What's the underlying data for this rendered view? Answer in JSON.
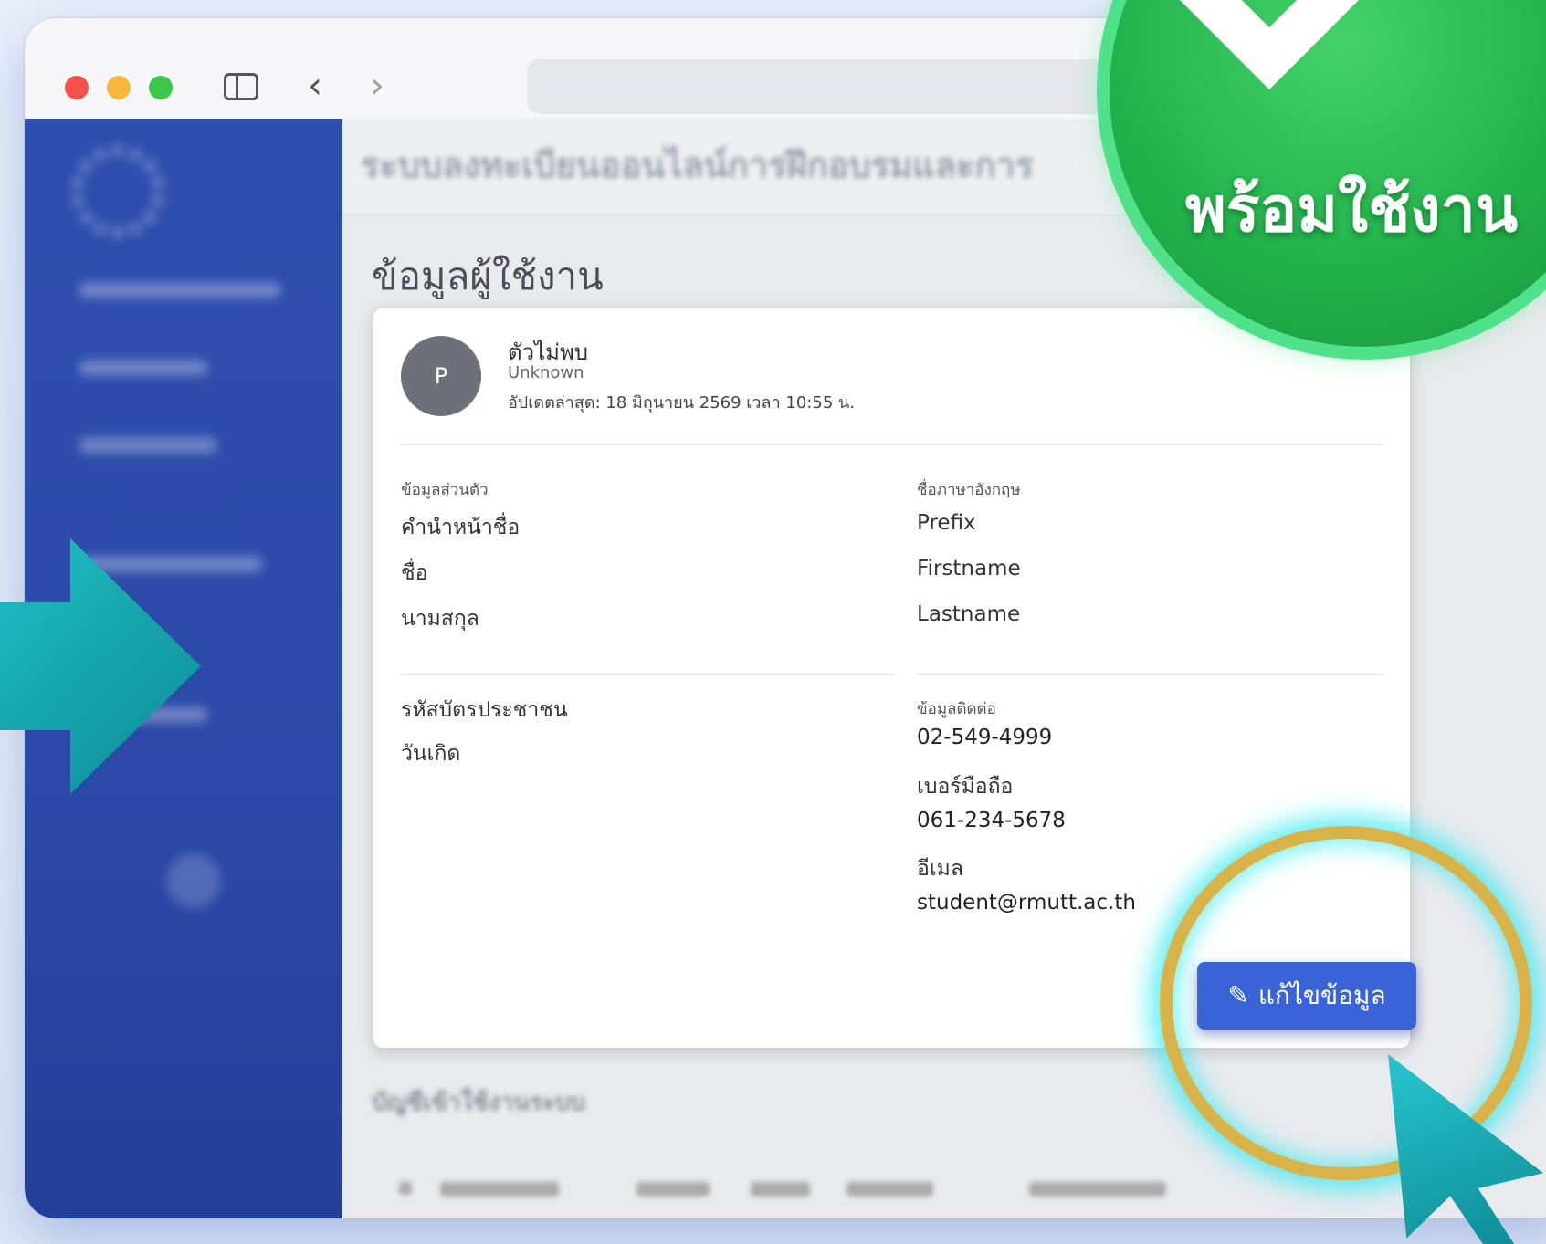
{
  "header": {
    "system_title": "ระบบลงทะเบียนออนไลน์การฝึกอบรมและการ"
  },
  "sidebar": {
    "logo_text": "",
    "items": []
  },
  "page": {
    "title": "ข้อมูลผู้ใช้งาน"
  },
  "profile": {
    "avatar_initial": "P",
    "name": "ตัวไม่พบ",
    "role": "Unknown",
    "updated": "อัปเดตล่าสุด: 18 มิถุนายน 2569 เวลา 10:55 น."
  },
  "personal": {
    "section_label": "ข้อมูลส่วนตัว",
    "prefix_label": "คำนำหน้าชื่อ",
    "firstname_label": "ชื่อ",
    "lastname_label": "นามสกุล",
    "id_card_label": "รหัสบัตรประชาชน",
    "birthdate_label": "วันเกิด"
  },
  "english_name": {
    "section_label": "ชื่อภาษาอังกฤษ",
    "prefix": "Prefix",
    "firstname": "Firstname",
    "lastname": "Lastname"
  },
  "contact": {
    "section_label": "ข้อมูลติดต่อ",
    "phone": "02-549-4999",
    "mobile_label": "เบอร์มือถือ",
    "mobile": "061-234-5678",
    "email_label": "อีเมล",
    "email": "student@rmutt.ac.th"
  },
  "actions": {
    "edit_label": "แก้ไขข้อมูล"
  },
  "section2": {
    "title": "บัญชีเข้าใช้งานระบบ"
  },
  "badge": {
    "text": "พร้อมใช้งาน"
  },
  "colors": {
    "primary": "#3a63d8",
    "sidebar": "#2f4fae",
    "badge": "#22b24b",
    "glow": "#45f0ff"
  }
}
